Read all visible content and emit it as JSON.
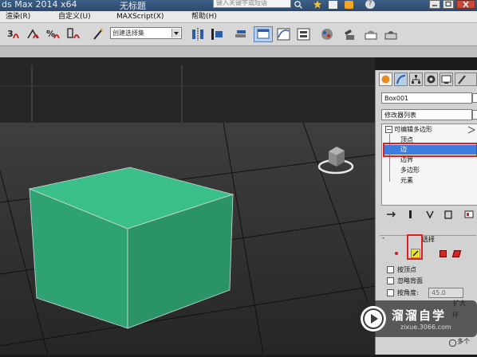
{
  "titlebar": {
    "title_left": "ds Max  2014 x64",
    "title_right": "无标题",
    "search_placeholder": "键入关键字或短语",
    "help_label": "?"
  },
  "menubar": {
    "items": [
      "渲染(R)",
      "自定义(U)",
      "MAXScript(X)",
      "帮助(H)"
    ]
  },
  "toolbar": {
    "selection_set_label": "创建选择集"
  },
  "command_panel": {
    "object_name": "Box001",
    "modifier_list_label": "修改器列表",
    "stack_root": "可编辑多边形",
    "stack_items": [
      "顶点",
      "边",
      "边界",
      "多边形",
      "元素"
    ],
    "selected_item": "边",
    "selection_rollout_title": "选择",
    "by_vertex_label": "按顶点",
    "ignore_backfacing_label": "忽略背面",
    "by_angle_label": "按角度:",
    "by_angle_value": "45.0",
    "expand_label": "扩大",
    "ring_label": "环",
    "loop_label": "多个"
  },
  "watermark": {
    "brand": "溜溜自学",
    "url": "zixue.3066.com"
  },
  "colors": {
    "box_green": "#2fa273",
    "selection_highlight": "#3d7ddf",
    "red_outline": "#e02020",
    "title_bar_blue": "#35557a"
  }
}
